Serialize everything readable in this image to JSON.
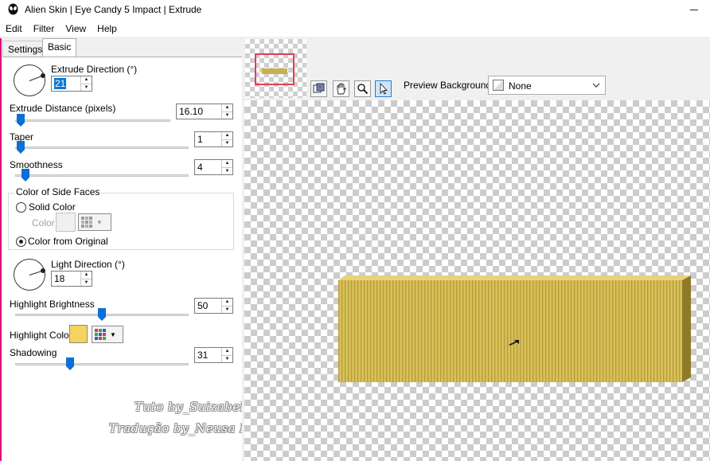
{
  "window": {
    "title": "Alien Skin | Eye Candy 5 Impact | Extrude"
  },
  "menu": [
    "Edit",
    "Filter",
    "View",
    "Help"
  ],
  "tabs": [
    "Settings",
    "Basic"
  ],
  "basic": {
    "extrude_direction": {
      "label": "Extrude Direction (°)",
      "value": "21"
    },
    "extrude_distance": {
      "label": "Extrude Distance (pixels)",
      "value": "16.10"
    },
    "taper": {
      "label": "Taper",
      "value": "1"
    },
    "smoothness": {
      "label": "Smoothness",
      "value": "4"
    },
    "side_faces": {
      "title": "Color of Side Faces",
      "solid_color_label": "Solid Color",
      "color_label": "Color",
      "from_original_label": "Color from Original",
      "selected": "Color from Original"
    },
    "light_direction": {
      "label": "Light Direction (°)",
      "value": "18"
    },
    "highlight_brightness": {
      "label": "Highlight Brightness",
      "value": "50"
    },
    "highlight_color": {
      "label": "Highlight Color",
      "swatch": "#f4d35e"
    },
    "shadowing": {
      "label": "Shadowing",
      "value": "31"
    }
  },
  "watermark": [
    "Tuto by_Suizabella",
    "Tradução by_Neusa Novaes"
  ],
  "preview": {
    "background_label": "Preview Background:",
    "background_value": "None",
    "object_color": "#d9c05a"
  },
  "colors": {
    "accent": "#0078d7",
    "nav_rect": "#e04050"
  }
}
